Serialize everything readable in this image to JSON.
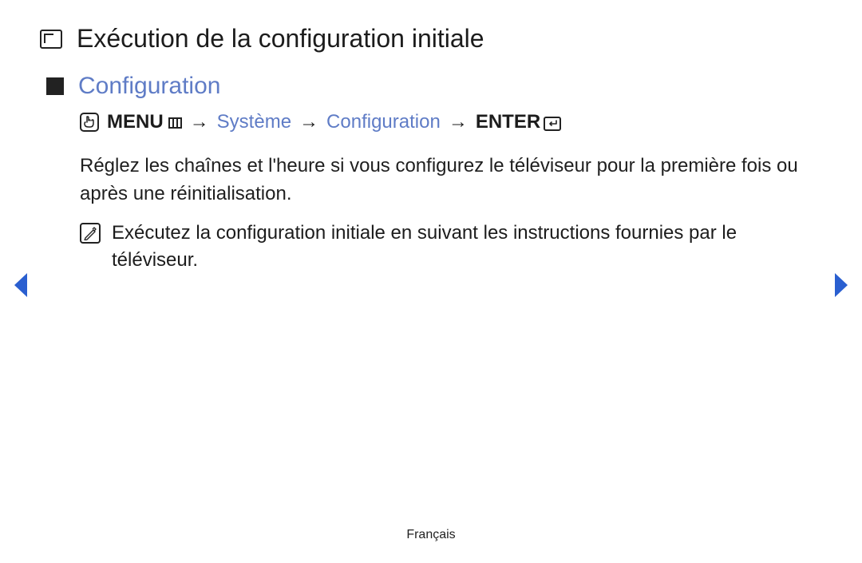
{
  "colors": {
    "heading_blue": "#5f7cc6",
    "nav_blue": "#2a5fd0",
    "text": "#1c1c1c"
  },
  "title": "Exécution de la configuration initiale",
  "section_heading": "Configuration",
  "breadcrumb": {
    "menu_label": "MENU",
    "arrow1": "→",
    "step1": "Système",
    "arrow2": "→",
    "step2": "Configuration",
    "arrow3": "→",
    "enter_label": "ENTER"
  },
  "body_paragraph": "Réglez les chaînes et l'heure si vous configurez le téléviseur pour la première fois ou après une réinitialisation.",
  "note_paragraph": "Exécutez la configuration initiale en suivant les instructions fournies par le téléviseur.",
  "footer_language": "Français"
}
